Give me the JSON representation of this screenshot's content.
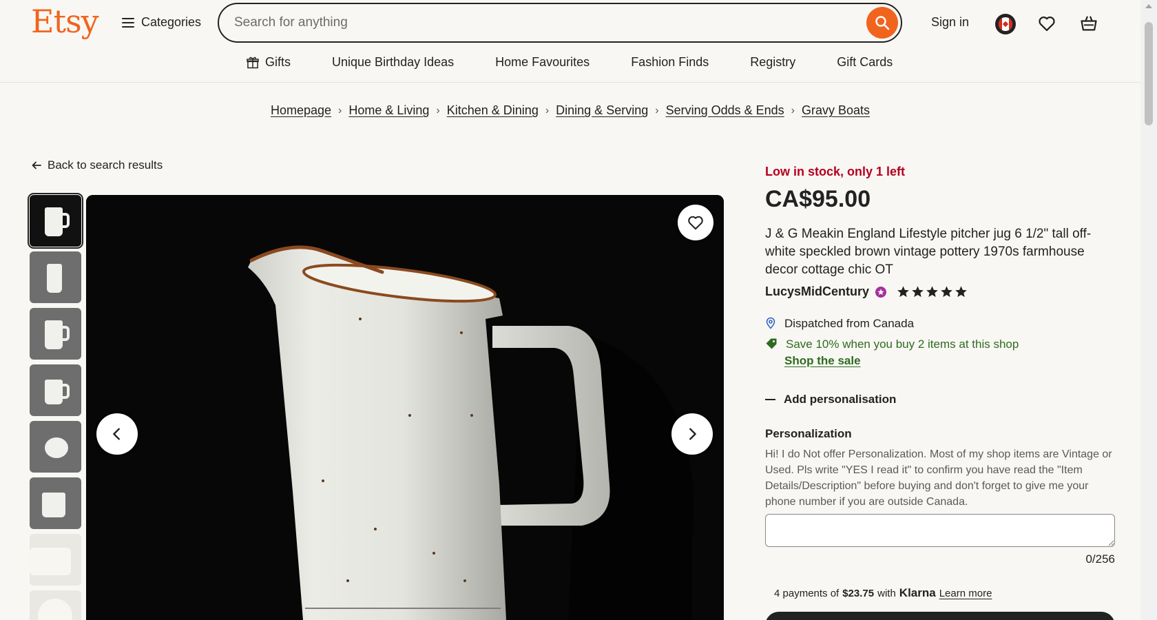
{
  "header": {
    "logo": "Etsy",
    "categories_label": "Categories",
    "search_placeholder": "Search for anything",
    "signin_label": "Sign in",
    "subnav": [
      "Gifts",
      "Unique Birthday Ideas",
      "Home Favourites",
      "Fashion Finds",
      "Registry",
      "Gift Cards"
    ]
  },
  "breadcrumb": [
    "Homepage",
    "Home & Living",
    "Kitchen & Dining",
    "Dining & Serving",
    "Serving Odds & Ends",
    "Gravy Boats"
  ],
  "back_link": "Back to search results",
  "gallery": {
    "thumbnail_count": 8,
    "active_index": 0
  },
  "product": {
    "stock_notice": "Low in stock, only 1 left",
    "price": "CA$95.00",
    "title": "J & G Meakin England Lifestyle pitcher jug 6 1/2\" tall off-white speckled brown vintage pottery 1970s farmhouse decor cottage chic OT",
    "seller": "LucysMidCentury",
    "rating_stars": 5,
    "dispatch": "Dispatched from Canada",
    "sale_text": "Save 10% when you buy 2 items at this shop",
    "sale_link": "Shop the sale",
    "add_personalisation": "Add personalisation",
    "personalization_label": "Personalization",
    "personalization_text": "Hi! I do Not offer Personalization. Most of my shop items are Vintage or Used. Pls write \"YES I read it\" to confirm you have read the \"Item Details/Description\" before buying and don't forget to give me your phone number if you are outside Canada.",
    "char_counter": "0/256",
    "klarna": {
      "prefix": "4 payments of",
      "amount": "$23.75",
      "mid": "with",
      "brand": "Klarna",
      "link": "Learn more"
    }
  },
  "colors": {
    "brand_orange": "#f1641e",
    "stock_red": "#b4001f",
    "sale_green": "#2e6b1f",
    "background": "#f8f7f3"
  },
  "icons": [
    "hamburger-icon",
    "search-icon",
    "flag-icon",
    "heart-icon",
    "cart-icon",
    "gift-icon",
    "arrow-left-icon",
    "chevron-left-icon",
    "chevron-right-icon",
    "star-seller-icon",
    "star-icon",
    "location-pin-icon",
    "tag-icon"
  ]
}
